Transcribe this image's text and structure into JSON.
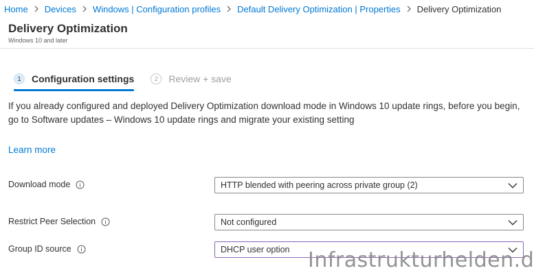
{
  "breadcrumb": {
    "items": [
      "Home",
      "Devices",
      "Windows | Configuration profiles",
      "Default Delivery Optimization | Properties"
    ],
    "current": "Delivery Optimization"
  },
  "header": {
    "title": "Delivery Optimization",
    "subtitle": "Windows 10 and later"
  },
  "steps": [
    {
      "number": "1",
      "label": "Configuration settings",
      "state": "active"
    },
    {
      "number": "2",
      "label": "Review + save",
      "state": "inactive"
    }
  ],
  "info": {
    "text": "If you already configured and deployed Delivery Optimization download mode in Windows 10 update rings, before you begin, go to Software updates – Windows 10 update rings and migrate your existing setting",
    "learn_more": "Learn more"
  },
  "settings": {
    "download_mode": {
      "label": "Download mode",
      "value": "HTTP blended with peering across private group (2)"
    },
    "restrict_peer": {
      "label": "Restrict Peer Selection",
      "value": "Not configured"
    },
    "group_id_source": {
      "label": "Group ID source",
      "value": "DHCP user option"
    }
  },
  "watermark": "Infrastrukturhelden.de",
  "colors": {
    "link": "#0078d4",
    "text": "#323130",
    "muted": "#a19f9d",
    "focus_border": "#8764b8"
  }
}
